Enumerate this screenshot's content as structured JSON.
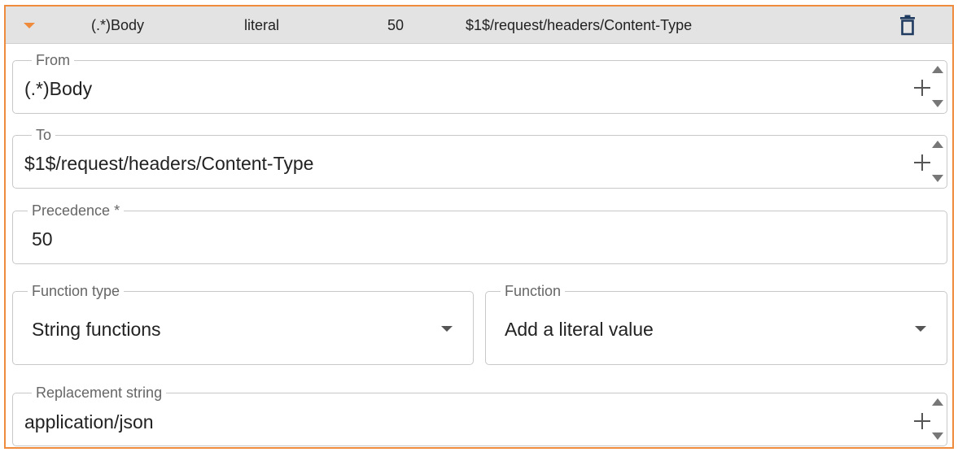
{
  "row": {
    "from": "(.*)Body",
    "function": "literal",
    "precedence": "50",
    "to": "$1$/request/headers/Content-Type"
  },
  "fields": {
    "from": {
      "label": "From",
      "value": "(.*)Body"
    },
    "to": {
      "label": "To",
      "value": "$1$/request/headers/Content-Type"
    },
    "precedence": {
      "label": "Precedence *",
      "value": "50"
    },
    "function_type": {
      "label": "Function type",
      "value": "String functions"
    },
    "function": {
      "label": "Function",
      "value": "Add a literal value"
    },
    "replacement": {
      "label": "Replacement string",
      "value": "application/json"
    }
  },
  "icons": {
    "collapse": "caret-down-icon",
    "delete": "trash-icon",
    "add": "plus-icon",
    "dropdown": "chevron-down-icon"
  },
  "colors": {
    "accent": "#ef8b3d",
    "header_bg": "#e3e3e3",
    "delete_icon": "#1f3a5f"
  }
}
